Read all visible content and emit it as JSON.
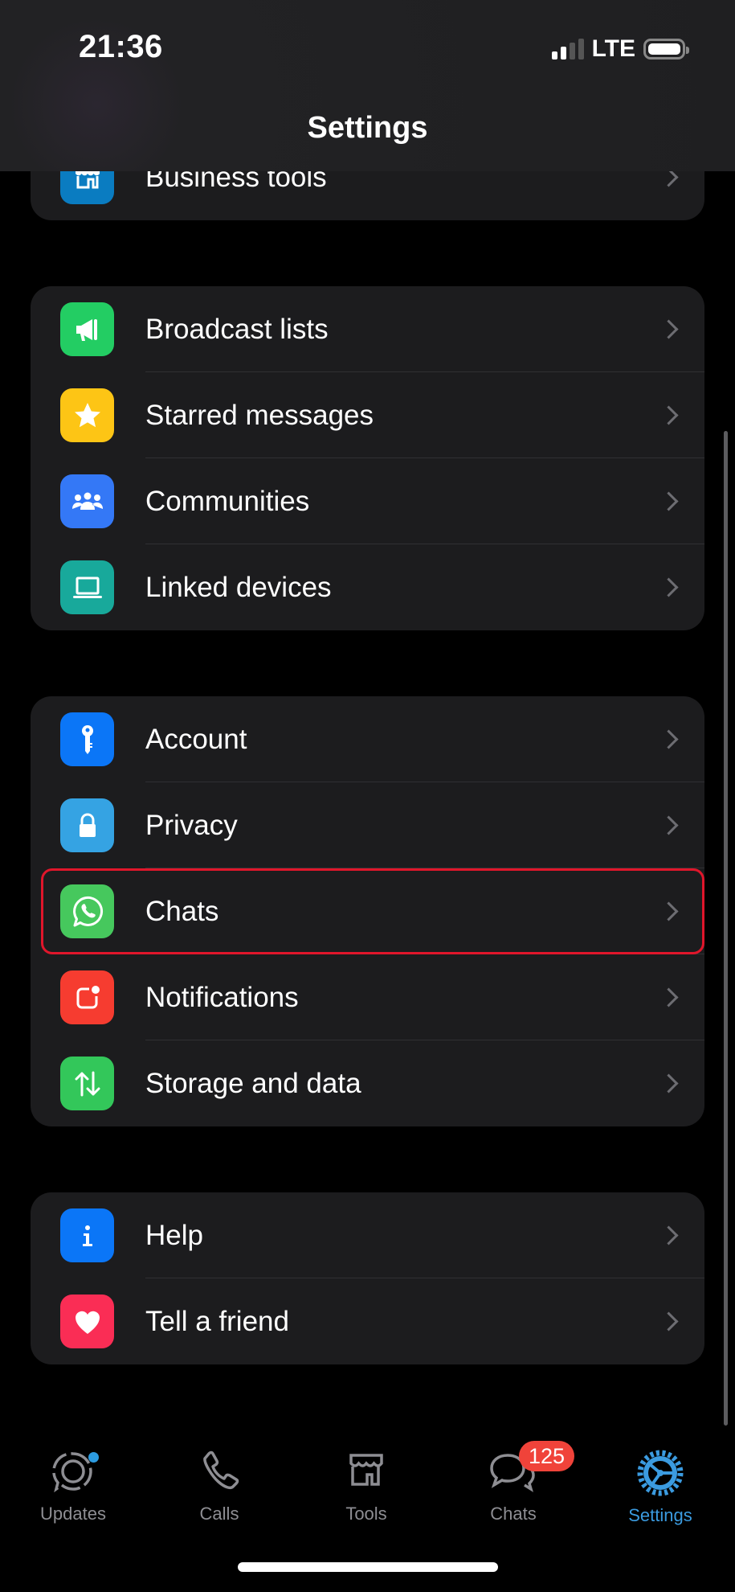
{
  "status_bar": {
    "time": "21:36",
    "network": "LTE",
    "signal_bars_active": 2,
    "signal_bars_total": 4,
    "battery_level": 1.0
  },
  "header": {
    "title": "Settings"
  },
  "groups": [
    {
      "items": [
        {
          "label": "Business tools",
          "icon": "store-icon",
          "color": "#0a7cc1"
        }
      ]
    },
    {
      "items": [
        {
          "label": "Broadcast lists",
          "icon": "megaphone-icon",
          "color": "#23cd63"
        },
        {
          "label": "Starred messages",
          "icon": "star-icon",
          "color": "#fdc515"
        },
        {
          "label": "Communities",
          "icon": "people-icon",
          "color": "#3478f6"
        },
        {
          "label": "Linked devices",
          "icon": "laptop-icon",
          "color": "#18a99b"
        }
      ]
    },
    {
      "items": [
        {
          "label": "Account",
          "icon": "key-icon",
          "color": "#0b76f7"
        },
        {
          "label": "Privacy",
          "icon": "lock-icon",
          "color": "#35a3e3"
        },
        {
          "label": "Chats",
          "icon": "whatsapp-icon",
          "color": "#46c85d",
          "highlighted": true
        },
        {
          "label": "Notifications",
          "icon": "notification-icon",
          "color": "#f63c30"
        },
        {
          "label": "Storage and data",
          "icon": "arrows-updown-icon",
          "color": "#33c75a"
        }
      ]
    },
    {
      "items": [
        {
          "label": "Help",
          "icon": "info-icon",
          "color": "#0b76f7"
        },
        {
          "label": "Tell a friend",
          "icon": "heart-icon",
          "color": "#fa2d55"
        }
      ]
    }
  ],
  "tabbar": {
    "tabs": [
      {
        "label": "Updates",
        "icon": "updates-icon",
        "has_dot": true
      },
      {
        "label": "Calls",
        "icon": "phone-icon"
      },
      {
        "label": "Tools",
        "icon": "store-icon"
      },
      {
        "label": "Chats",
        "icon": "chat-bubbles-icon",
        "badge": "125"
      },
      {
        "label": "Settings",
        "icon": "gear-icon",
        "active": true
      }
    ],
    "active_color": "#3b9be0",
    "inactive_color": "#8e8e93",
    "badge_color": "#f0433a"
  },
  "highlight_color": "#e0162b"
}
